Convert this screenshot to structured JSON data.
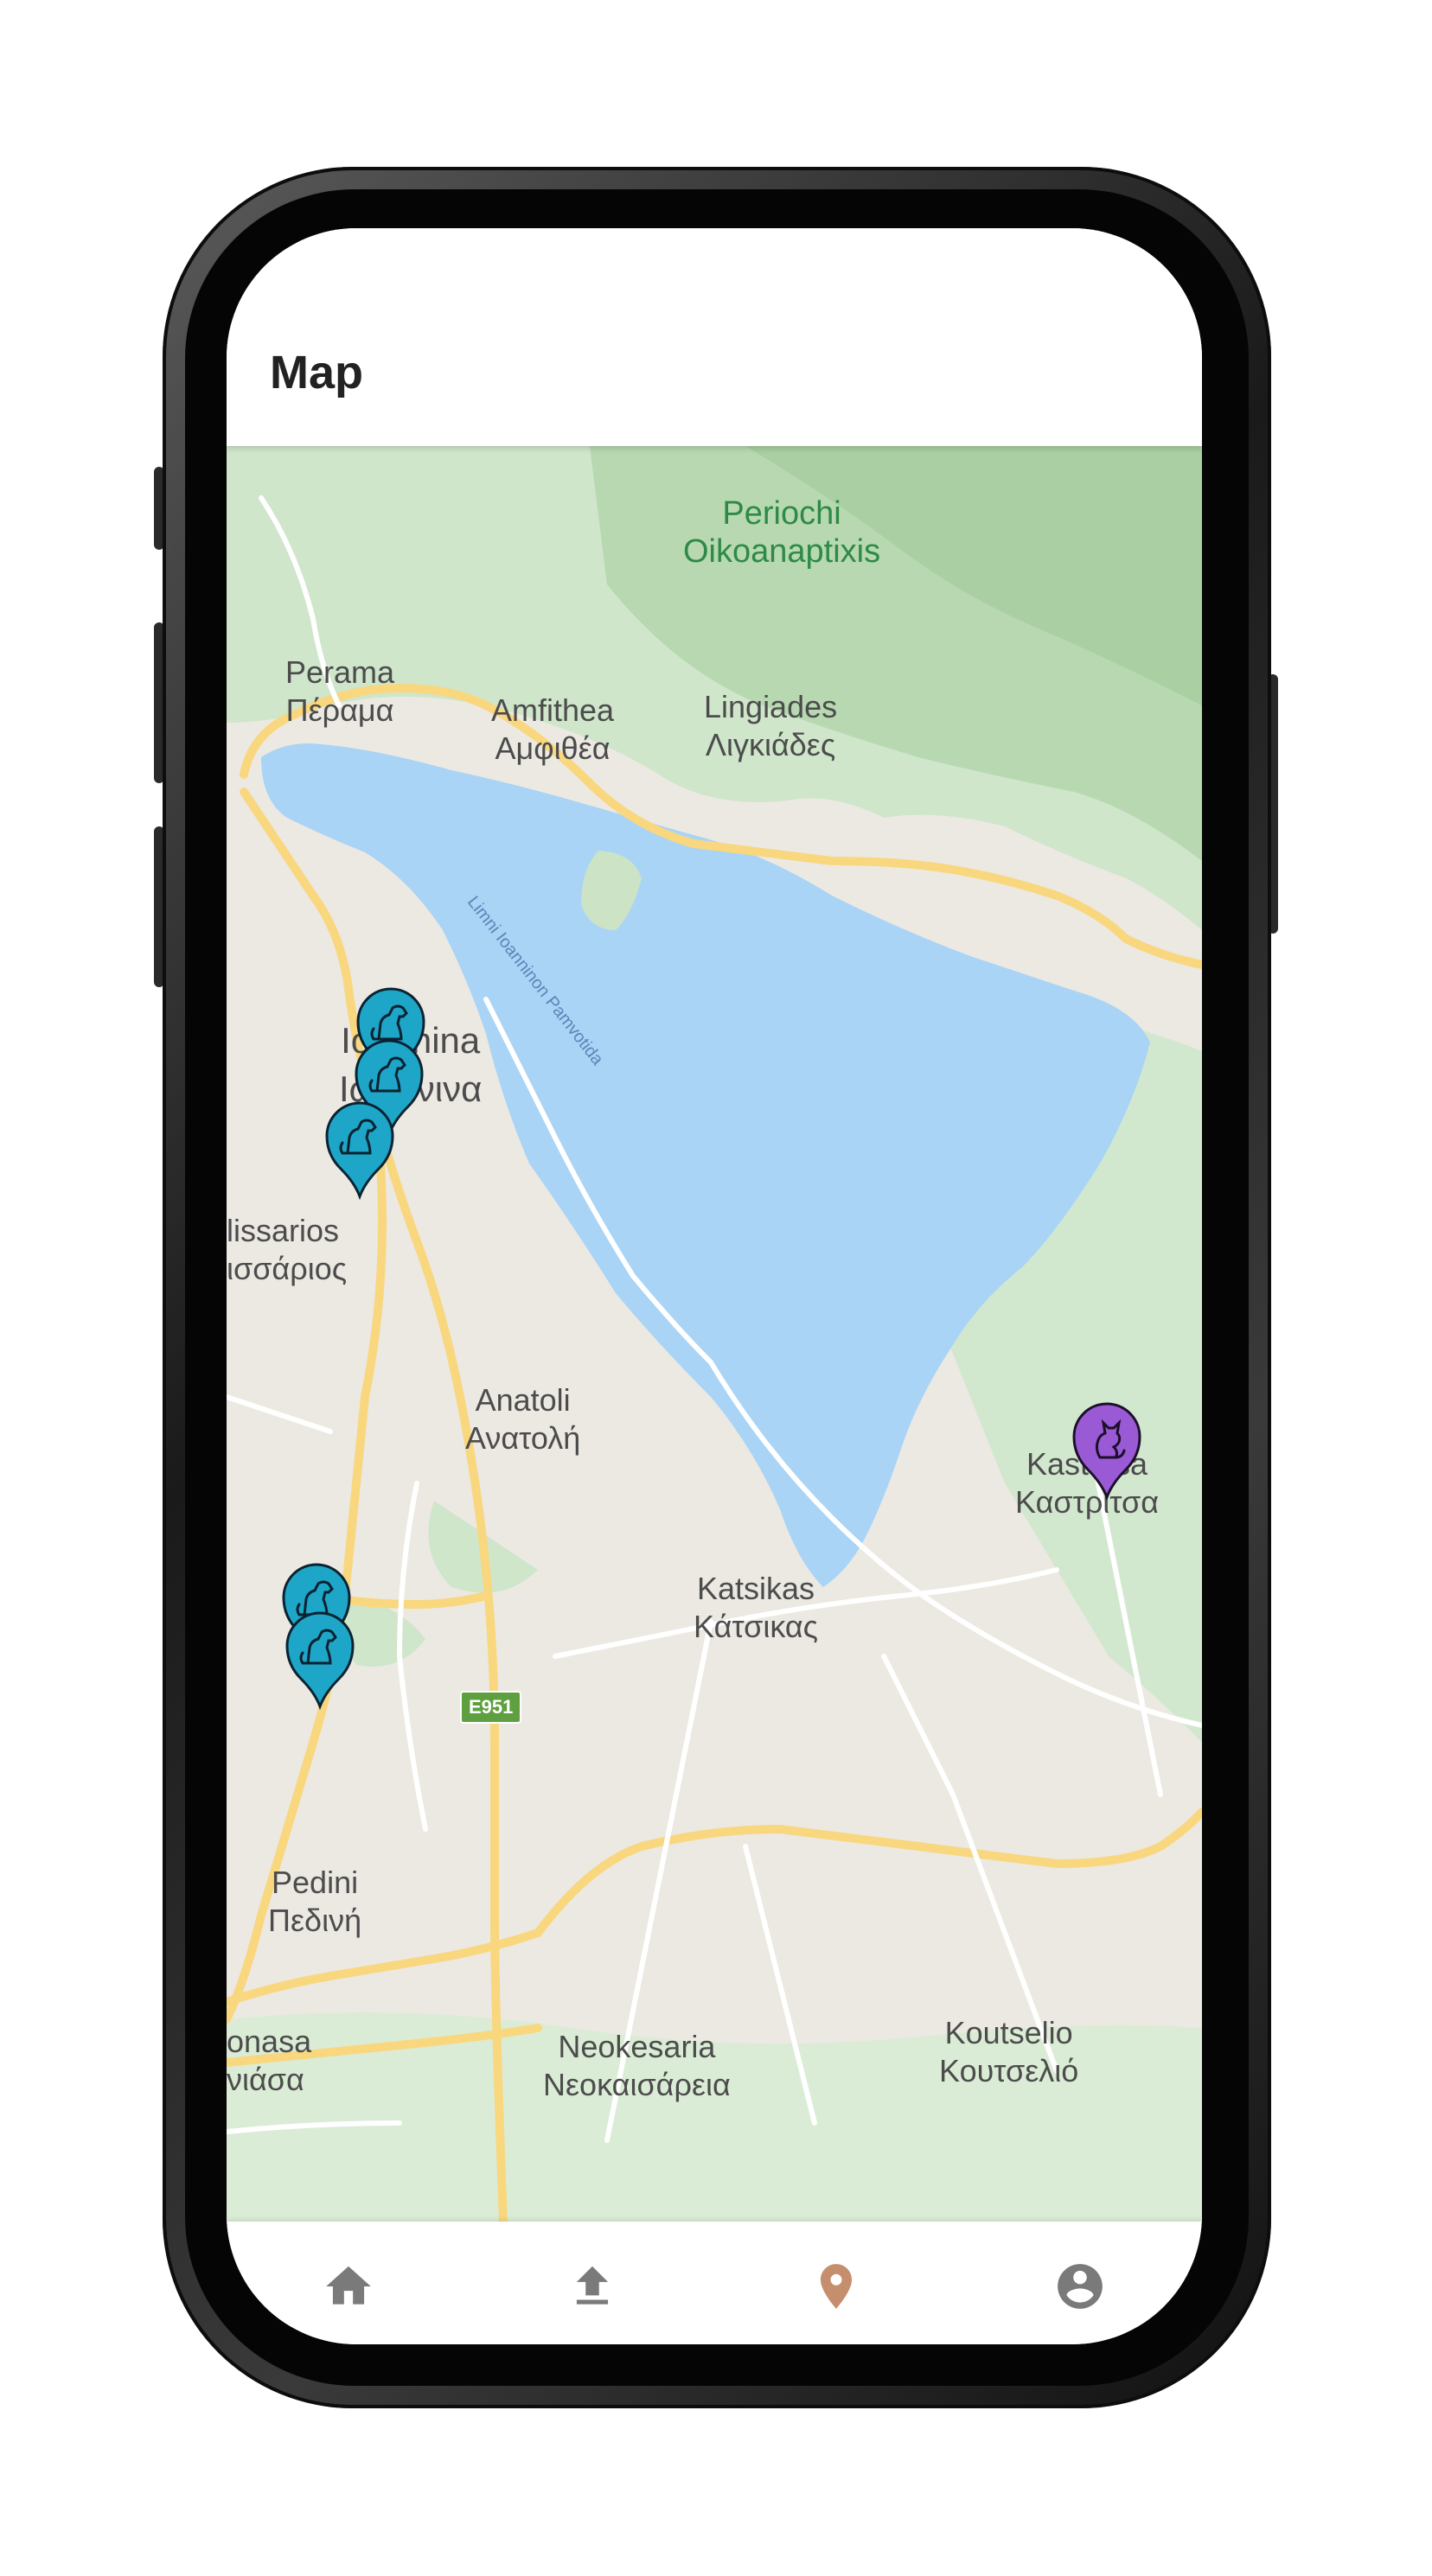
{
  "app": {
    "title": "Map",
    "accent_color": "#c58f6e",
    "inactive_color": "#7a7a7a"
  },
  "map": {
    "places": [
      {
        "id": "perioxi",
        "name_latin": "Periochi",
        "name_local": "Oikoanaptixis"
      },
      {
        "id": "perama",
        "name_latin": "Perama",
        "name_local": "Πέραμα"
      },
      {
        "id": "amfithea",
        "name_latin": "Amfithea",
        "name_local": "Αμφιθέα"
      },
      {
        "id": "lingiades",
        "name_latin": "Lingiades",
        "name_local": "Λιγκιάδες"
      },
      {
        "id": "ioannina",
        "name_latin": "Ioannina",
        "name_local": "Ιωάννινα"
      },
      {
        "id": "lissarios",
        "name_latin": "lissarios",
        "name_local": "ισσάριος"
      },
      {
        "id": "anatoli",
        "name_latin": "Anatoli",
        "name_local": "Ανατολή"
      },
      {
        "id": "kastritsa",
        "name_latin": "Kastritsa",
        "name_local": "Καστρίτσα"
      },
      {
        "id": "katsikas",
        "name_latin": "Katsikas",
        "name_local": "Κάτσικας"
      },
      {
        "id": "pedini",
        "name_latin": "Pedini",
        "name_local": "Πεδινή"
      },
      {
        "id": "bonasa",
        "name_latin": "onasa",
        "name_local": "νιάσα"
      },
      {
        "id": "neokesaria",
        "name_latin": "Neokesaria",
        "name_local": "Νεοκαισάρεια"
      },
      {
        "id": "koutselio",
        "name_latin": "Koutselio",
        "name_local": "Κουτσελιό"
      }
    ],
    "lake_label": "Limni Ioanninon Pamvotida",
    "road_shield": "E951",
    "markers": [
      {
        "type": "dog",
        "color": "#1ea6c9"
      },
      {
        "type": "dog",
        "color": "#1ea6c9"
      },
      {
        "type": "dog",
        "color": "#1ea6c9"
      },
      {
        "type": "dog",
        "color": "#1ea6c9"
      },
      {
        "type": "dog",
        "color": "#1ea6c9"
      },
      {
        "type": "cat",
        "color": "#9a5ad6"
      }
    ]
  },
  "bottom_nav": {
    "items": [
      {
        "id": "home",
        "icon": "home-icon",
        "active": false
      },
      {
        "id": "upload",
        "icon": "upload-icon",
        "active": false
      },
      {
        "id": "map",
        "icon": "location-pin-icon",
        "active": true
      },
      {
        "id": "profile",
        "icon": "account-circle-icon",
        "active": false
      }
    ]
  }
}
